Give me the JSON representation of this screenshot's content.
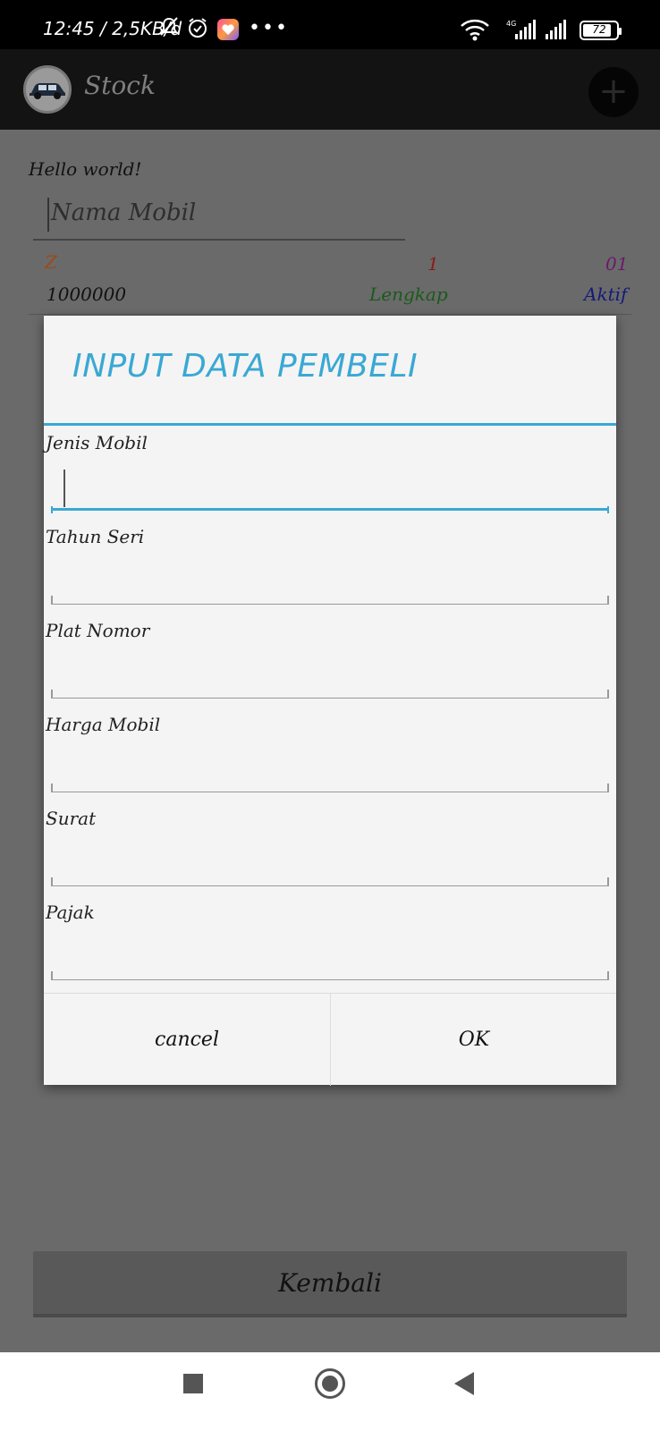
{
  "status_bar": {
    "time": "12:45 / 2,5KB/d",
    "battery": "72",
    "network": "4G"
  },
  "app_bar": {
    "title": "Stock",
    "add_symbol": "+"
  },
  "background": {
    "hello": "Hello world!",
    "nama_placeholder": "Nama Mobil",
    "row1": {
      "a": "Z",
      "b": "1",
      "c": "01"
    },
    "row2": {
      "a": "1000000",
      "b": "Lengkap",
      "c": "Aktif"
    },
    "kembali": "Kembali"
  },
  "colors": {
    "row1_a": "#9a4a1a",
    "row1_b": "#8a1a1a",
    "row1_c": "#6a1a6a",
    "row2_b": "#1a5a1a",
    "row2_c": "#141a7a",
    "accent": "#3aa8d4"
  },
  "dialog": {
    "title": "INPUT DATA PEMBELI",
    "fields": [
      {
        "label": "Jenis Mobil",
        "value": ""
      },
      {
        "label": "Tahun Seri",
        "value": ""
      },
      {
        "label": "Plat Nomor",
        "value": ""
      },
      {
        "label": "Harga Mobil",
        "value": ""
      },
      {
        "label": "Surat",
        "value": ""
      },
      {
        "label": "Pajak",
        "value": ""
      }
    ],
    "cancel": "cancel",
    "ok": "OK"
  }
}
